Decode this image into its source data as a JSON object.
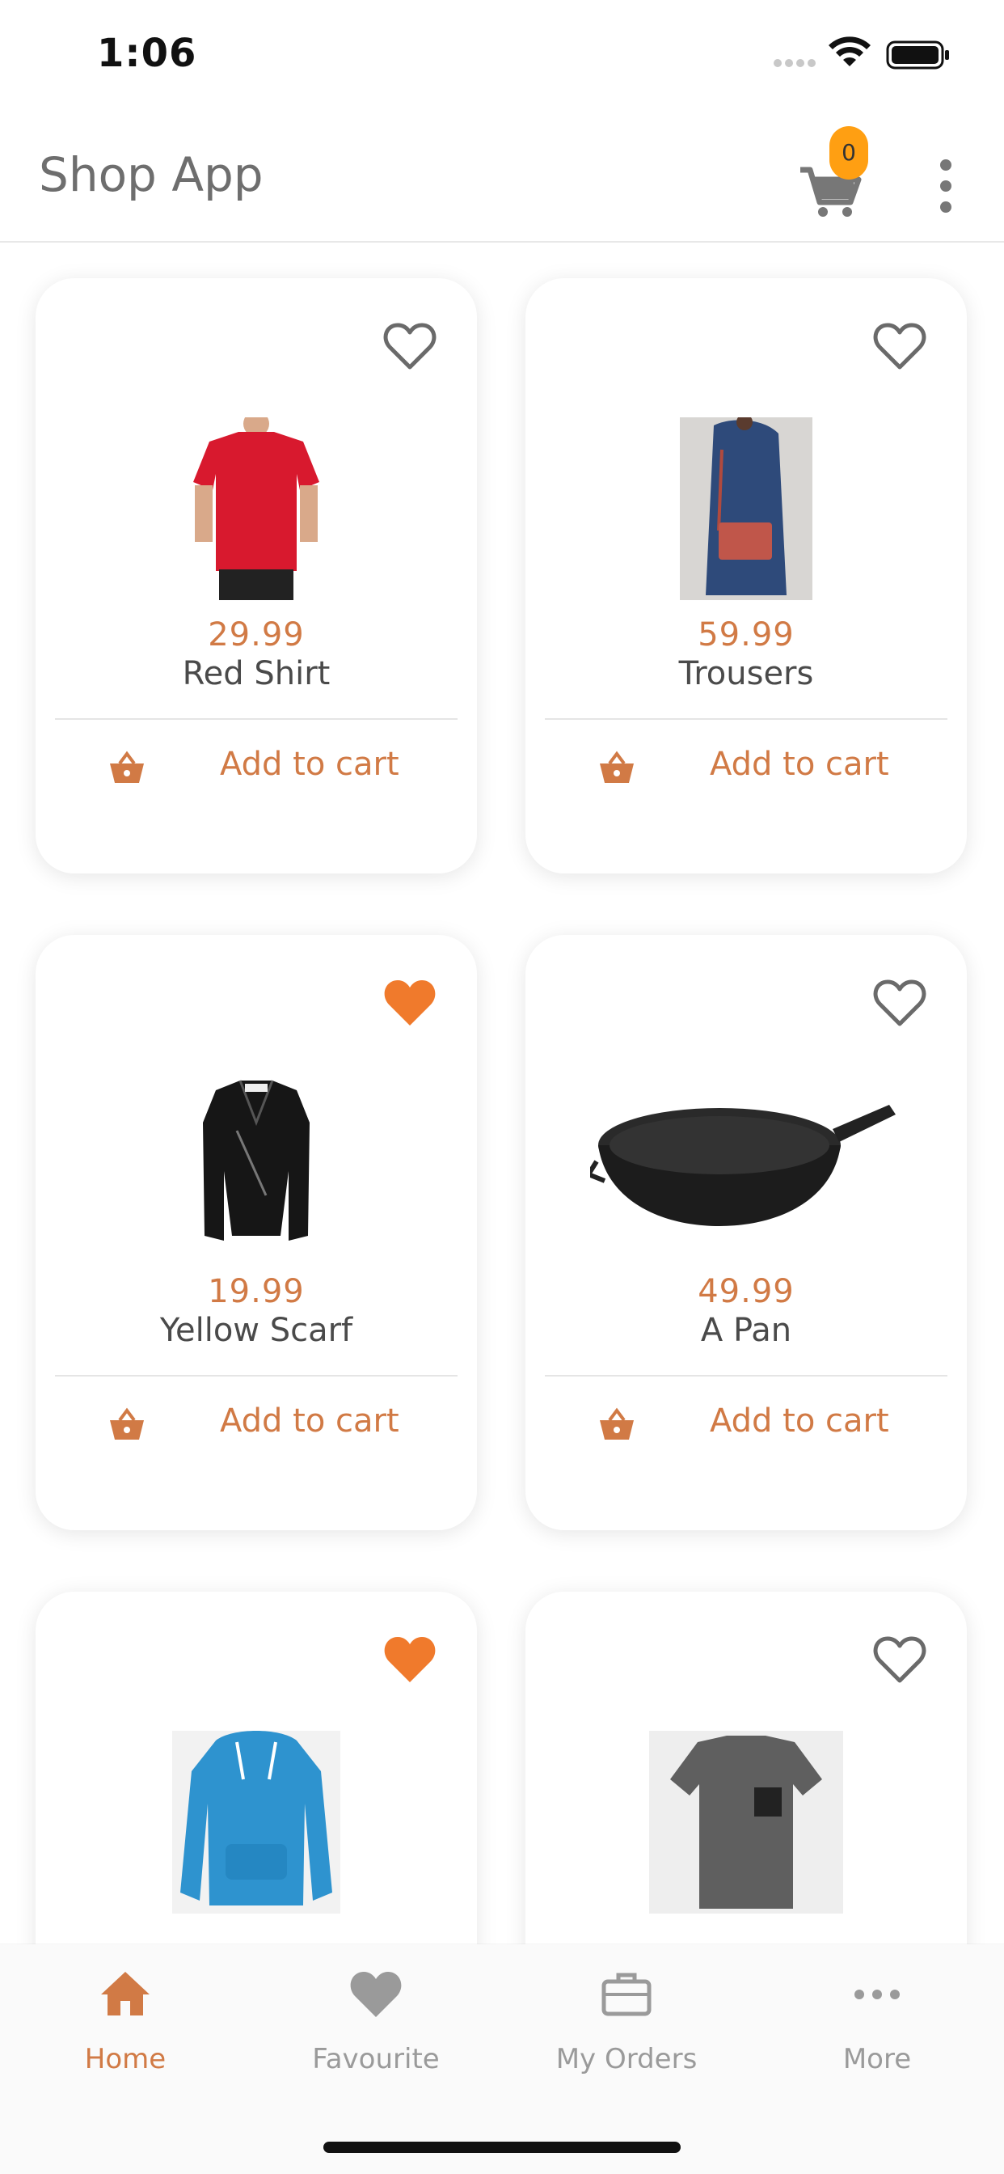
{
  "status": {
    "time": "1:06"
  },
  "app": {
    "title": "Shop App",
    "cart_count": "0"
  },
  "colors": {
    "accent": "#d17a45",
    "badge": "#ff9f12",
    "favorite": "#f07a2c",
    "muted": "#9a9a9a"
  },
  "products": [
    {
      "name": "Red Shirt",
      "price": "29.99",
      "favorite": false,
      "action": "Add to cart",
      "image": "red-shirt-image"
    },
    {
      "name": "Trousers",
      "price": "59.99",
      "favorite": false,
      "action": "Add to cart",
      "image": "handbag-image"
    },
    {
      "name": "Yellow Scarf",
      "price": "19.99",
      "favorite": true,
      "action": "Add to cart",
      "image": "leather-jacket-image"
    },
    {
      "name": "A Pan",
      "price": "49.99",
      "favorite": false,
      "action": "Add to cart",
      "image": "pan-image"
    },
    {
      "name": "",
      "price": "",
      "favorite": true,
      "action": "",
      "image": "blue-hoodie-image"
    },
    {
      "name": "",
      "price": "",
      "favorite": false,
      "action": "",
      "image": "grey-tshirt-image"
    }
  ],
  "nav": [
    {
      "label": "Home",
      "icon": "home-icon",
      "active": true
    },
    {
      "label": "Favourite",
      "icon": "heart-icon",
      "active": false
    },
    {
      "label": "My Orders",
      "icon": "briefcase-icon",
      "active": false
    },
    {
      "label": "More",
      "icon": "more-icon",
      "active": false
    }
  ]
}
